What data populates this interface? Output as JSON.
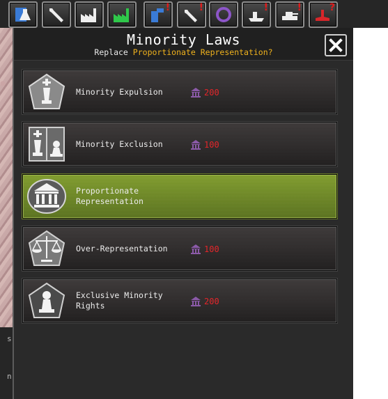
{
  "toolbar": {
    "buttons": [
      {
        "icon": "research-flask-icon",
        "color": "#4b8fe0",
        "alert": ""
      },
      {
        "icon": "wrench-icon",
        "color": "#e8e8e8",
        "alert": ""
      },
      {
        "icon": "factory-icon",
        "color": "#e8e8e8",
        "alert": ""
      },
      {
        "icon": "factory-green-icon",
        "color": "#34c94b",
        "alert": ""
      },
      {
        "icon": "market-blue-icon",
        "color": "#4b8fe0",
        "alert": "!"
      },
      {
        "icon": "military-wrench-icon",
        "color": "#e8e8e8",
        "alert": "!"
      },
      {
        "icon": "ring-icon",
        "color": "#8d56c9",
        "alert": ""
      },
      {
        "icon": "trade-ship-icon",
        "color": "#e8e8e8",
        "alert": "!"
      },
      {
        "icon": "tank-icon",
        "color": "#e8e8e8",
        "alert": "!"
      },
      {
        "icon": "bugle-red-icon",
        "color": "#d8262a",
        "alert": "?"
      }
    ]
  },
  "panel": {
    "title": "Minority Laws",
    "subtitle_prefix": "Replace",
    "subtitle_highlight": "Proportionate Representation?",
    "close_label": "✕"
  },
  "laws": [
    {
      "label": "Minority Expulsion",
      "cost": "200",
      "icon": "king-piece-icon",
      "active": false
    },
    {
      "label": "Minority Exclusion",
      "cost": "100",
      "icon": "king-and-pawn-icon",
      "active": false
    },
    {
      "label": "Proportionate Representation",
      "cost": "",
      "icon": "parliament-building-icon",
      "active": true
    },
    {
      "label": "Over-Representation",
      "cost": "100",
      "icon": "scales-icon",
      "active": false
    },
    {
      "label": "Exclusive Minority Rights",
      "cost": "200",
      "icon": "pawn-piece-icon",
      "active": false
    }
  ],
  "colors": {
    "active_law": "#6e8a22",
    "cost_text": "#e5262a",
    "highlight": "#f0b21d"
  },
  "left_strip": {
    "fragment_1": "s",
    "fragment_2": "n"
  }
}
